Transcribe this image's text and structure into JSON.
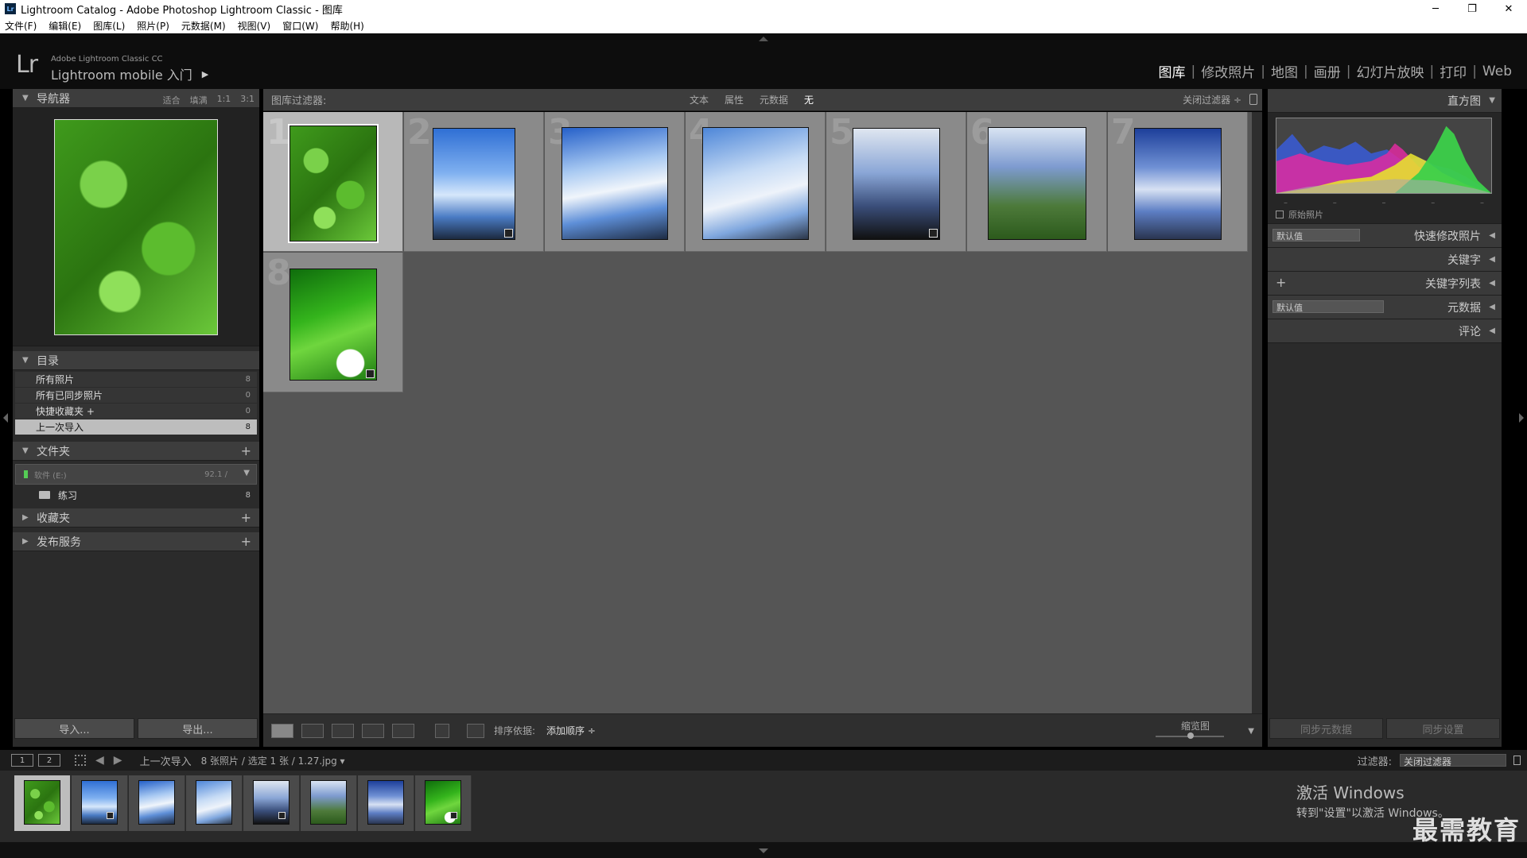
{
  "window": {
    "title": "Lightroom Catalog - Adobe Photoshop Lightroom Classic - 图库",
    "app_icon": "Lr",
    "controls": [
      "─",
      "❐",
      "✕"
    ]
  },
  "menu": [
    "文件(F)",
    "编辑(E)",
    "图库(L)",
    "照片(P)",
    "元数据(M)",
    "视图(V)",
    "窗口(W)",
    "帮助(H)"
  ],
  "header": {
    "logo": "Lr",
    "brand_small": "Adobe Lightroom Classic CC",
    "brand_main": "Lightroom mobile 入门",
    "modules": [
      {
        "label": "图库",
        "active": true
      },
      {
        "label": "修改照片",
        "active": false
      },
      {
        "label": "地图",
        "active": false
      },
      {
        "label": "画册",
        "active": false
      },
      {
        "label": "幻灯片放映",
        "active": false
      },
      {
        "label": "打印",
        "active": false
      },
      {
        "label": "Web",
        "active": false
      }
    ]
  },
  "navigator": {
    "title": "导航器",
    "zoom_options": [
      "适合",
      "填满",
      "1:1",
      "3:1"
    ]
  },
  "catalog": {
    "title": "目录",
    "items": [
      {
        "label": "所有照片",
        "count": "8",
        "selected": false
      },
      {
        "label": "所有已同步照片",
        "count": "0",
        "selected": false
      },
      {
        "label": "快捷收藏夹 +",
        "count": "0",
        "selected": false
      },
      {
        "label": "上一次导入",
        "count": "8",
        "selected": true
      }
    ]
  },
  "folders": {
    "title": "文件夹",
    "volume_name": "软件 (E:)",
    "volume_size": "92.1 /",
    "items": [
      {
        "label": "练习",
        "count": "8"
      }
    ]
  },
  "collections": {
    "title": "收藏夹"
  },
  "publish": {
    "title": "发布服务"
  },
  "left_buttons": {
    "import": "导入...",
    "export": "导出..."
  },
  "filter_bar": {
    "label": "图库过滤器:",
    "options": [
      {
        "label": "文本",
        "active": false
      },
      {
        "label": "属性",
        "active": false
      },
      {
        "label": "元数据",
        "active": false
      },
      {
        "label": "无",
        "active": true
      }
    ],
    "close": "关闭过滤器 ÷"
  },
  "grid": {
    "photos": [
      {
        "num": "1",
        "style": "p-clover",
        "selected": true,
        "badge": false
      },
      {
        "num": "2",
        "style": "p-sky1",
        "selected": false,
        "badge": true
      },
      {
        "num": "3",
        "style": "p-sky2",
        "selected": false,
        "badge": false
      },
      {
        "num": "4",
        "style": "p-sky3",
        "selected": false,
        "badge": false
      },
      {
        "num": "5",
        "style": "p-pole1",
        "selected": false,
        "badge": true
      },
      {
        "num": "6",
        "style": "p-pole2",
        "selected": false,
        "badge": false
      },
      {
        "num": "7",
        "style": "p-clouds",
        "selected": false,
        "badge": false
      },
      {
        "num": "8",
        "style": "p-leaves",
        "selected": false,
        "badge": true
      }
    ]
  },
  "toolbar": {
    "sort_label": "排序依据:",
    "sort_value": "添加顺序 ÷",
    "thumb_label": "缩览图"
  },
  "right_panel": {
    "histogram_title": "直方图",
    "original_photo": "原始照片",
    "histo_ticks": [
      "–",
      "–",
      "–",
      "–",
      "–"
    ],
    "sections": [
      {
        "label": "快速修改照片",
        "preset": "默认值"
      },
      {
        "label": "关键字",
        "preset": ""
      },
      {
        "label": "关键字列表",
        "preset": "",
        "plus": true
      },
      {
        "label": "元数据",
        "preset": "默认值"
      },
      {
        "label": "评论",
        "preset": ""
      }
    ],
    "sync_meta": "同步元数据",
    "sync_settings": "同步设置"
  },
  "filmstrip_bar": {
    "monitor1": "1",
    "monitor2": "2",
    "source": "上一次导入",
    "count": "8 张照片 / 选定 1 张 / 1.27.jpg ▾",
    "filter_label": "过滤器:",
    "filter_value": "关闭过滤器"
  },
  "activation": {
    "line1": "激活 Windows",
    "line2": "转到\"设置\"以激活 Windows。"
  },
  "watermark": "最需教育"
}
